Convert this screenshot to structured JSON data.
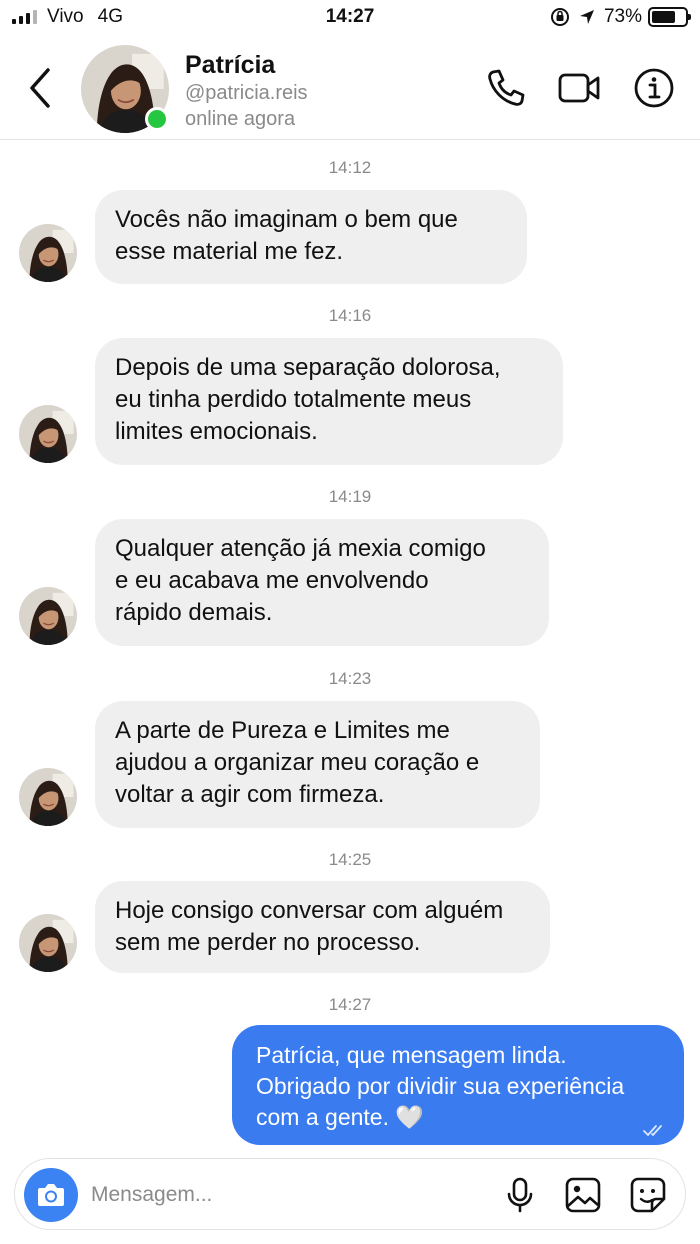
{
  "status_bar": {
    "carrier": "Vivo",
    "network": "4G",
    "time": "14:27",
    "battery": "73%",
    "battery_level": 0.73
  },
  "header": {
    "name": "Patrícia",
    "handle": "@patricia.reis",
    "status": "online agora",
    "icons": [
      "back-arrow-icon",
      "phone-icon",
      "video-camera-icon",
      "info-icon"
    ]
  },
  "messages": [
    {
      "time": "14:12",
      "from": "contact",
      "text": "Vocês não imaginam o bem que\nesse material me fez."
    },
    {
      "time": "14:16",
      "from": "contact",
      "text": "Depois de uma separação dolorosa,\neu tinha perdido totalmente meus\nlimites emocionais."
    },
    {
      "time": "14:19",
      "from": "contact",
      "text": "Qualquer atenção já mexia comigo\ne eu acabava me envolvendo\nrápido demais."
    },
    {
      "time": "14:23",
      "from": "contact",
      "text": "A parte de Pureza e Limites me\najudou a organizar meu coração e\nvoltar a agir com firmeza."
    },
    {
      "time": "14:25",
      "from": "contact",
      "text": "Hoje consigo conversar com alguém\nsem me perder no processo."
    },
    {
      "time": "14:27",
      "from": "me",
      "text": "Patrícia, que mensagem linda.\nObrigado por dividir sua experiência\ncom a gente. 🤍"
    }
  ],
  "composer": {
    "placeholder": "Mensagem...",
    "icons": [
      "camera-icon",
      "microphone-icon",
      "gallery-icon",
      "sticker-icon"
    ]
  },
  "colors": {
    "accent": "#3a7cf0",
    "incoming_bubble": "#efefef",
    "online": "#26c740"
  }
}
